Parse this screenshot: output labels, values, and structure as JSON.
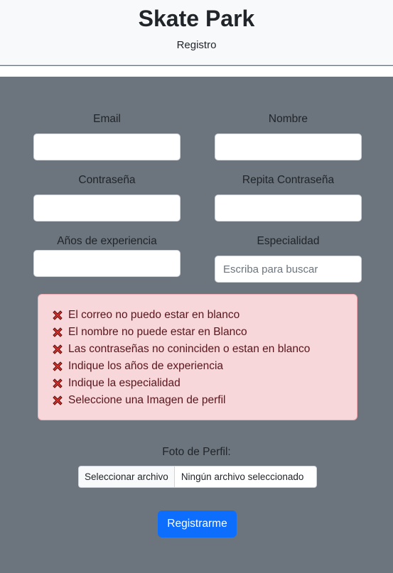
{
  "header": {
    "title": "Skate Park",
    "subtitle": "Registro"
  },
  "form": {
    "email": {
      "label": "Email",
      "value": ""
    },
    "nombre": {
      "label": "Nombre",
      "value": ""
    },
    "password": {
      "label": "Contraseña",
      "value": ""
    },
    "password_repeat": {
      "label": "Repita Contraseña",
      "value": ""
    },
    "experiencia": {
      "label": "Años de experiencia",
      "value": ""
    },
    "especialidad": {
      "label": "Especialidad",
      "value": "",
      "placeholder": "Escriba para buscar"
    }
  },
  "errors": [
    {
      "icon": "cross-mark-icon",
      "text": "El correo no puedo estar en blanco"
    },
    {
      "icon": "cross-mark-icon",
      "text": "El nombre no puede estar en Blanco"
    },
    {
      "icon": "cross-mark-icon",
      "text": "Las contraseñas no coninciden o estan en blanco"
    },
    {
      "icon": "cross-mark-icon",
      "text": "Indique los años de experiencia"
    },
    {
      "icon": "cross-mark-icon",
      "text": "Indique la especialidad"
    },
    {
      "icon": "cross-mark-icon",
      "text": "Seleccione una Imagen de perfil"
    }
  ],
  "photo": {
    "label": "Foto de Perfil:",
    "button_label": "Seleccionar archivo",
    "status": "Ningún archivo seleccionado"
  },
  "submit": {
    "label": "Registrarme"
  },
  "colors": {
    "page_background": "#6c757d",
    "header_background": "#f8f9fa",
    "alert_background": "#f8d7da",
    "alert_border": "#f1aeb5",
    "alert_text": "#58151c",
    "primary_button": "#0d6efd",
    "error_icon": "#d9332b"
  }
}
